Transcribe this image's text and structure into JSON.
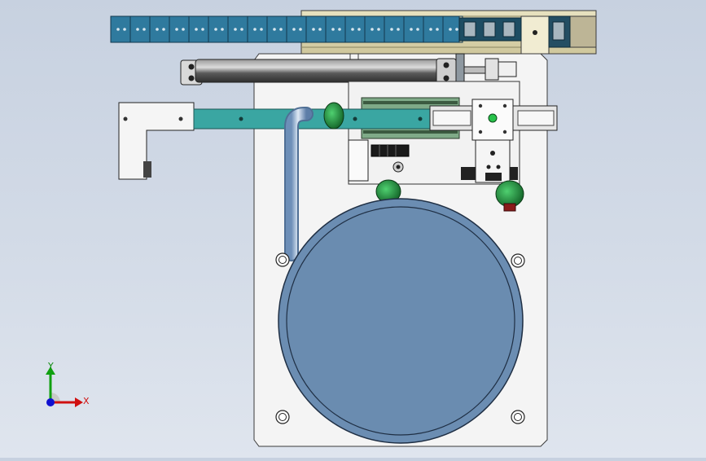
{
  "app": {
    "view": "cad-3d-model-viewport"
  },
  "triad": {
    "x_label": "X",
    "y_label": "Y",
    "colors": {
      "x": "#d01010",
      "y": "#10a010",
      "z": "#1010d0"
    }
  },
  "colors": {
    "background": "#d3dbe7",
    "plate": "#f3f3f3",
    "cable_chain": "#2f7a9e",
    "slide_bar": "#3aa6a2",
    "tank": "#6b8db2",
    "cylinder": "#555555",
    "fitting_green": "#1f8f3a"
  }
}
